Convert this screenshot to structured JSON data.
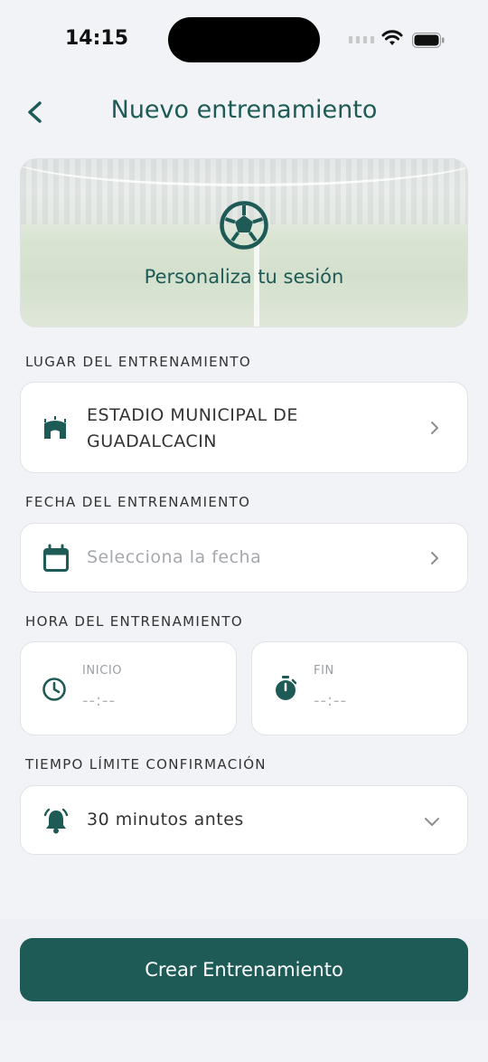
{
  "status_bar": {
    "time": "14:15"
  },
  "header": {
    "title": "Nuevo entrenamiento"
  },
  "hero": {
    "text": "Personaliza tu sesión"
  },
  "location": {
    "label": "LUGAR DEL ENTRENAMIENTO",
    "value_line1": "ESTADIO MUNICIPAL DE",
    "value_line2": "GUADALCACIN"
  },
  "date": {
    "label": "FECHA DEL ENTRENAMIENTO",
    "placeholder": "Selecciona la fecha"
  },
  "time": {
    "label": "HORA DEL ENTRENAMIENTO",
    "start_label": "INICIO",
    "start_value": "--:--",
    "end_label": "FIN",
    "end_value": "--:--"
  },
  "confirmation": {
    "label": "TIEMPO LÍMITE CONFIRMACIÓN",
    "value": "30 minutos antes"
  },
  "footer": {
    "create_label": "Crear Entrenamiento"
  },
  "icons": {
    "back": "chevron-left-icon",
    "ball": "soccer-ball-icon",
    "stadium": "stadium-icon",
    "calendar": "calendar-icon",
    "clock": "clock-icon",
    "stopwatch": "stopwatch-icon",
    "alarm": "alarm-bell-icon"
  },
  "colors": {
    "accent": "#1e5b56",
    "background": "#f2f3f7"
  }
}
